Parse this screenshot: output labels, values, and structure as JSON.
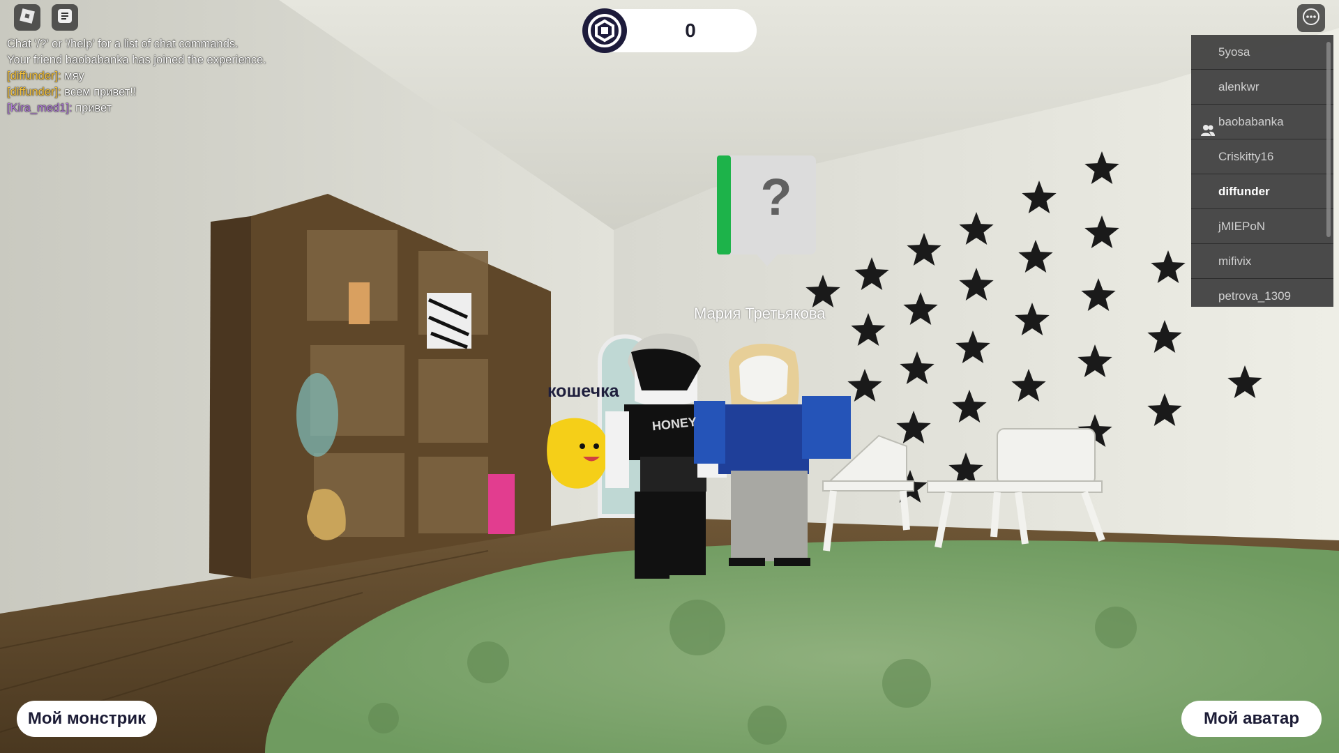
{
  "top_left": {
    "roblox_icon": "roblox-logo-icon",
    "chat_icon": "chat-icon"
  },
  "chat": {
    "system_lines": [
      "Chat '/?' or '/help' for a list of chat commands.",
      "Your friend baobabanka has joined the experience."
    ],
    "messages": [
      {
        "name": "[diffunder]:",
        "text": "мяу",
        "color": "#f5c23c"
      },
      {
        "name": "[diffunder]:",
        "text": "всем привет!!",
        "color": "#f5c23c"
      },
      {
        "name": "[Kira_med1]:",
        "text": "привет",
        "color": "#b07ad8"
      }
    ]
  },
  "currency": {
    "amount": "0",
    "icon": "robux-icon"
  },
  "menu": {
    "icon": "more-options-icon"
  },
  "player_list": {
    "players": [
      {
        "name": "5yosa",
        "friend": false,
        "self": false
      },
      {
        "name": "alenkwr",
        "friend": false,
        "self": false
      },
      {
        "name": "baobabanka",
        "friend": true,
        "self": false
      },
      {
        "name": "Criskitty16",
        "friend": false,
        "self": false
      },
      {
        "name": "diffunder",
        "friend": false,
        "self": true
      },
      {
        "name": "jMIEPoN",
        "friend": false,
        "self": false
      },
      {
        "name": "mifivix",
        "friend": false,
        "self": false
      },
      {
        "name": "petrova_1309",
        "friend": false,
        "self": false
      }
    ]
  },
  "scene": {
    "quest_marker": "?",
    "nametag_maria": "Мария Третьякова",
    "nametag_koshechka": "кошечка",
    "shirt_text": "HONEY"
  },
  "buttons": {
    "my_monster": "Мой монстрик",
    "my_avatar": "Мой аватар"
  }
}
